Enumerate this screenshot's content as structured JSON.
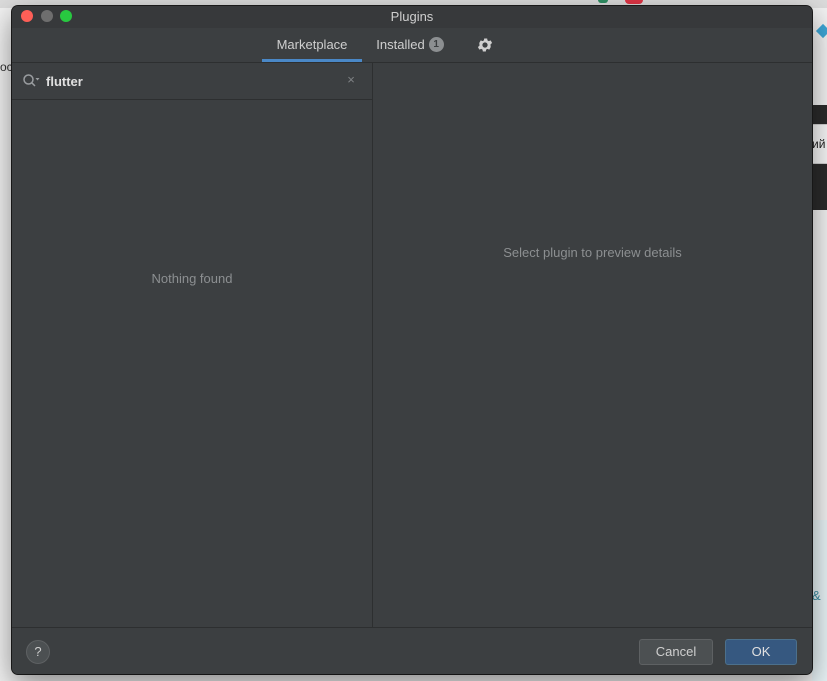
{
  "window": {
    "title": "Plugins"
  },
  "tabs": {
    "marketplace_label": "Marketplace",
    "installed_label": "Installed",
    "installed_count": "1",
    "settings_icon": "gear-icon"
  },
  "search": {
    "value": "flutter",
    "search_icon": "search-icon",
    "clear_icon": "close-icon",
    "clear_glyph": "×"
  },
  "left_pane": {
    "empty_text": "Nothing found"
  },
  "right_pane": {
    "preview_text": "Select plugin to preview details"
  },
  "footer": {
    "help_label": "?",
    "cancel_label": "Cancel",
    "ok_label": "OK"
  },
  "background": {
    "right_band_text": "ий",
    "right_bottom_text": "&",
    "left_text": "ос"
  },
  "colors": {
    "accent": "#4a88c7",
    "dialog_bg": "#3c3f41",
    "ok_button": "#365880",
    "close": "#fe5f57",
    "maximize": "#28c840"
  }
}
